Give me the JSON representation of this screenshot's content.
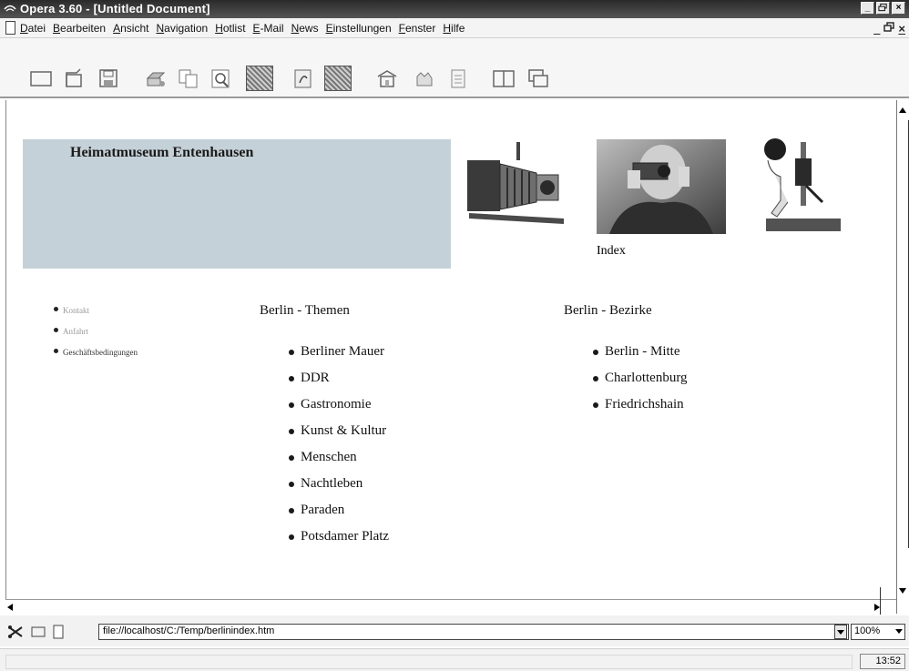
{
  "window": {
    "title": "Opera 3.60 - [Untitled Document]",
    "controls": [
      "_",
      "×"
    ]
  },
  "menu": {
    "items": [
      "Datei",
      "Bearbeiten",
      "Ansicht",
      "Navigation",
      "Hotlist",
      "E-Mail",
      "News",
      "Einstellungen",
      "Fenster",
      "Hilfe"
    ]
  },
  "page": {
    "banner_title": "Heimatmuseum Entenhausen",
    "index_label": "Index",
    "small_nav": [
      "Kontakt",
      "Anfahrt",
      "Geschäftsbedingungen"
    ],
    "themes": {
      "heading": "Berlin - Themen",
      "items": [
        "Berliner Mauer",
        "DDR",
        "Gastronomie",
        "Kunst & Kultur",
        "Menschen",
        "Nachtleben",
        "Paraden",
        "Potsdamer Platz"
      ]
    },
    "districts": {
      "heading": "Berlin - Bezirke",
      "items": [
        "Berlin - Mitte",
        "Charlottenburg",
        "Friedrichshain"
      ]
    }
  },
  "address": {
    "url": "file://localhost/C:/Temp/berlinindex.htm",
    "zoom": "100%"
  },
  "status": {
    "clock": "13:52"
  },
  "colors": {
    "banner": "#c5d1d8",
    "titlebar": "#333333"
  }
}
